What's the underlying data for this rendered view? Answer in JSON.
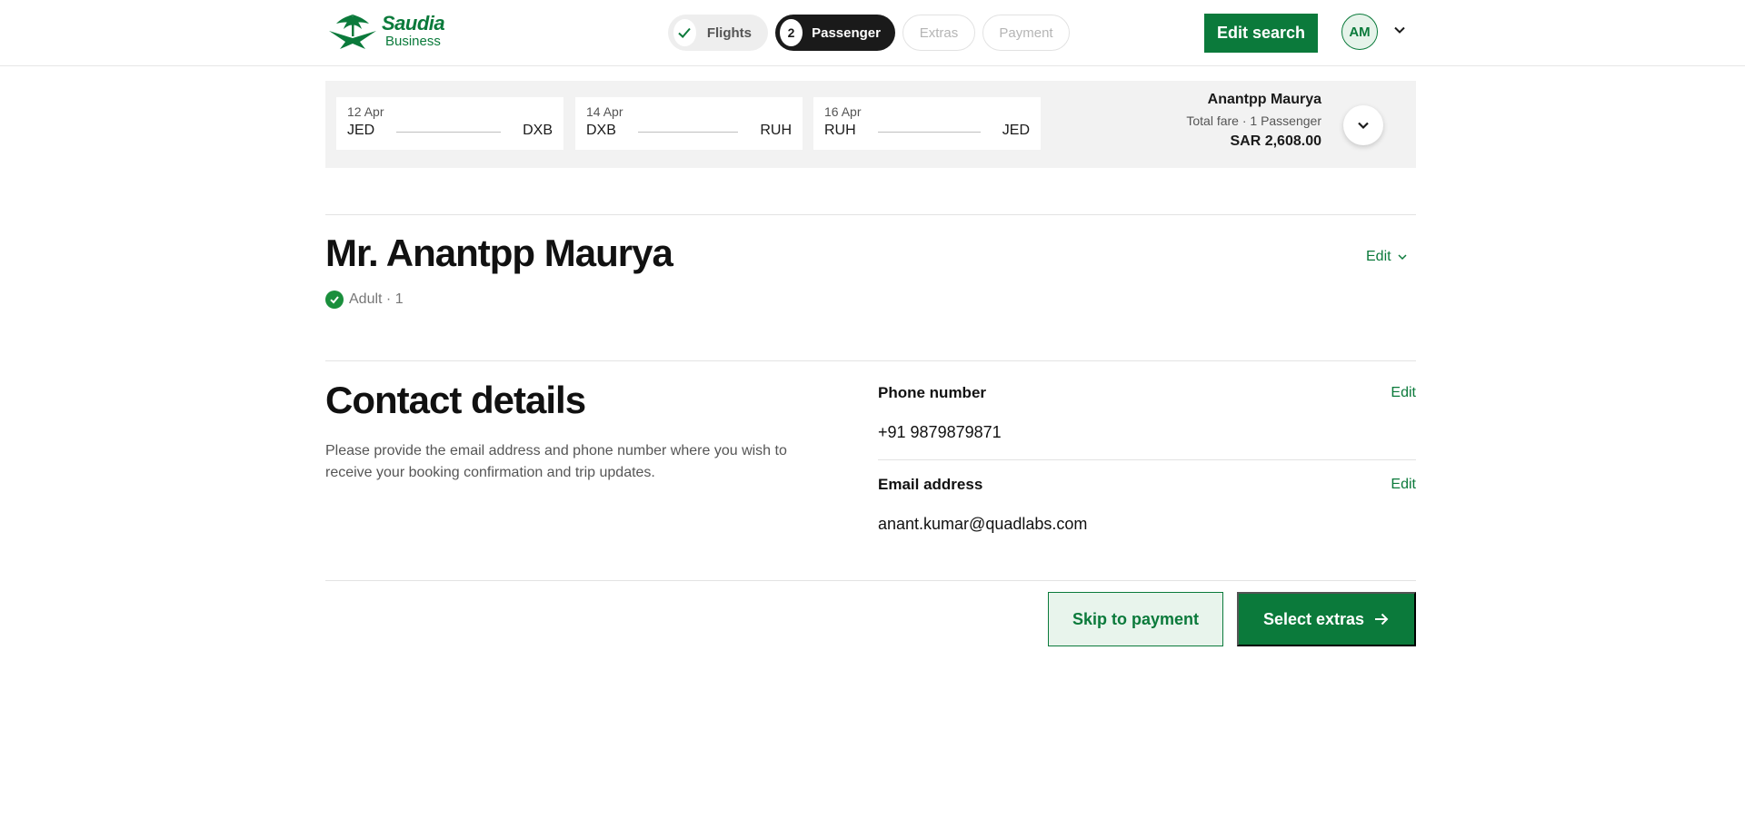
{
  "brand": {
    "name": "Saudia",
    "sub": "Business"
  },
  "steps": [
    {
      "label": "Flights",
      "state": "done"
    },
    {
      "label": "Passenger",
      "number": "2",
      "state": "active"
    },
    {
      "label": "Extras",
      "state": "upcoming"
    },
    {
      "label": "Payment",
      "state": "upcoming"
    }
  ],
  "header": {
    "edit_search": "Edit search",
    "avatar_initials": "AM"
  },
  "itinerary": {
    "segments": [
      {
        "date": "12 Apr",
        "from": "JED",
        "to": "DXB"
      },
      {
        "date": "14 Apr",
        "from": "DXB",
        "to": "RUH"
      },
      {
        "date": "16 Apr",
        "from": "RUH",
        "to": "JED"
      }
    ],
    "traveller": "Anantpp Maurya",
    "fare_label": "Total fare · 1 Passenger",
    "fare_amount": "SAR 2,608.00"
  },
  "passenger": {
    "name": "Mr. Anantpp Maurya",
    "type": "Adult · 1",
    "edit": "Edit"
  },
  "contact": {
    "title": "Contact details",
    "description": "Please provide the email address and phone number where you wish to receive your booking confirmation and trip updates.",
    "phone_label": "Phone number",
    "phone_value": "+91 9879879871",
    "email_label": "Email address",
    "email_value": "anant.kumar@quadlabs.com",
    "edit": "Edit"
  },
  "actions": {
    "skip": "Skip to payment",
    "next": "Select extras"
  },
  "colors": {
    "brand": "#0b7a3b",
    "dark": "#1a1a1a"
  }
}
